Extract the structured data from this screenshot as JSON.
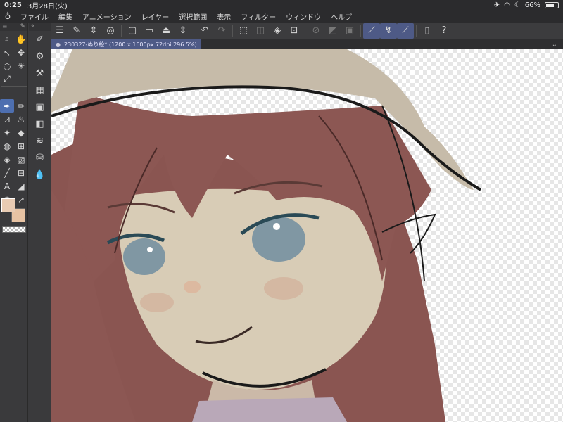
{
  "status": {
    "time": "0:25",
    "date": "3月28日(火)",
    "battery": "66%",
    "battery_level": 0.66
  },
  "menu": {
    "items": [
      "ファイル",
      "編集",
      "アニメーション",
      "レイヤー",
      "選択範囲",
      "表示",
      "フィルター",
      "ウィンドウ",
      "ヘルプ"
    ]
  },
  "commands": [
    {
      "name": "menu-icon",
      "glyph": "☰"
    },
    {
      "name": "edit-icon",
      "glyph": "✎"
    },
    {
      "name": "updown-icon",
      "glyph": "⇕"
    },
    {
      "name": "record-icon",
      "glyph": "◎"
    },
    {
      "name": "new-file-icon",
      "glyph": "▢"
    },
    {
      "name": "open-folder-icon",
      "glyph": "▭"
    },
    {
      "name": "save-icon",
      "glyph": "⏏"
    },
    {
      "name": "updown-icon-2",
      "glyph": "⇕"
    },
    {
      "name": "undo-icon",
      "glyph": "↶"
    },
    {
      "name": "redo-icon",
      "glyph": "↷"
    },
    {
      "name": "select-clear-icon",
      "glyph": "⬚"
    },
    {
      "name": "crop-icon",
      "glyph": "◫"
    },
    {
      "name": "fill-icon",
      "glyph": "◈"
    },
    {
      "name": "transform-icon",
      "glyph": "⊡"
    },
    {
      "name": "hide-selection-icon",
      "glyph": "⊘"
    },
    {
      "name": "invert-icon",
      "glyph": "◩"
    },
    {
      "name": "expand-icon",
      "glyph": "▣"
    },
    {
      "name": "pen-correction-icon",
      "glyph": "⟋"
    },
    {
      "name": "brush-stroke-icon",
      "glyph": "↯"
    },
    {
      "name": "line-icon",
      "glyph": "⟋"
    },
    {
      "name": "smartphone-icon",
      "glyph": "▯"
    },
    {
      "name": "help-icon",
      "glyph": "?"
    }
  ],
  "tools": [
    {
      "name": "zoom-tool-icon",
      "glyph": "⌕"
    },
    {
      "name": "hand-tool-icon",
      "glyph": "✋"
    },
    {
      "name": "object-tool-icon",
      "glyph": "↖"
    },
    {
      "name": "move-tool-icon",
      "glyph": "✥"
    },
    {
      "name": "lasso-tool-icon",
      "glyph": "◌"
    },
    {
      "name": "magic-wand-icon",
      "glyph": "✳"
    },
    {
      "name": "eyedropper-icon",
      "glyph": "⤢"
    },
    {
      "name": "divider",
      "glyph": ""
    },
    {
      "name": "pen-tool-icon",
      "glyph": "✒"
    },
    {
      "name": "pencil-tool-icon",
      "glyph": "✏"
    },
    {
      "name": "brush-tool-icon",
      "glyph": "⊿"
    },
    {
      "name": "airbrush-tool-icon",
      "glyph": "♨"
    },
    {
      "name": "decoration-tool-icon",
      "glyph": "✦"
    },
    {
      "name": "eraser-tool-icon",
      "glyph": "◆"
    },
    {
      "name": "blend-tool-icon",
      "glyph": "◍"
    },
    {
      "name": "ruler-tool-icon",
      "glyph": "⊞"
    },
    {
      "name": "fill-tool-icon",
      "glyph": "◈"
    },
    {
      "name": "gradient-tool-icon",
      "glyph": "▨"
    },
    {
      "name": "figure-tool-icon",
      "glyph": "╱"
    },
    {
      "name": "frame-tool-icon",
      "glyph": "⊟"
    },
    {
      "name": "text-tool-icon",
      "glyph": "A"
    },
    {
      "name": "balloon-tool-icon",
      "glyph": "◢"
    },
    {
      "name": "effect-line-icon",
      "glyph": "✸"
    },
    {
      "name": "correct-line-icon",
      "glyph": "↗"
    }
  ],
  "colors": {
    "main": "#e8cbb3",
    "sub": "#e8c3a3"
  },
  "subtools": [
    {
      "name": "subtool-pen-icon",
      "glyph": "✐"
    },
    {
      "name": "subtool-settings-icon",
      "glyph": "⚙"
    },
    {
      "name": "subtool-property-icon",
      "glyph": "⚒"
    },
    {
      "name": "subtool-detail-icon",
      "glyph": "▦"
    },
    {
      "name": "navigator-icon",
      "glyph": "▣"
    },
    {
      "name": "layer-icon",
      "glyph": "◧"
    },
    {
      "name": "layers-stack-icon",
      "glyph": "≋"
    },
    {
      "name": "material-icon",
      "glyph": "⛁"
    },
    {
      "name": "color-drops-icon",
      "glyph": "💧"
    }
  ],
  "tab": {
    "title": "230327-ぬり絵* (1200 x 1600px 72dpi 296.5%)"
  }
}
